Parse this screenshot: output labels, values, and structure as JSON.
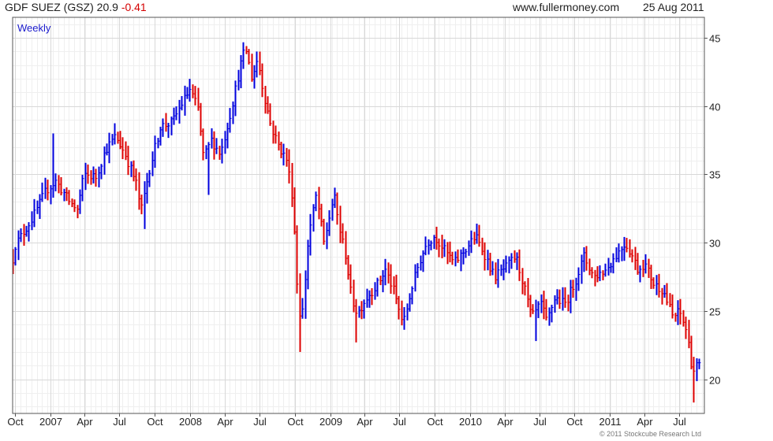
{
  "header": {
    "name": "GDF SUEZ (GSZ)",
    "price": "20.9",
    "change": "-0.41",
    "site": "www.fullermoney.com",
    "date": "25 Aug 2011"
  },
  "frequency_label": "Weekly",
  "copyright": "© 2011 Stockcube Research Ltd",
  "colors": {
    "up": "#0000dd",
    "down": "#dd0000",
    "grid": "#d8d8d8",
    "frame": "#555555"
  },
  "chart_data": {
    "type": "bar",
    "style": "hlc-price-bars",
    "frequency": "weekly",
    "y_axis_side": "right",
    "ylim": [
      17.5,
      46.5
    ],
    "yticks": [
      20,
      25,
      30,
      35,
      40,
      45
    ],
    "xlim": [
      "2006-09-25",
      "2011-09-05"
    ],
    "xticks": [
      {
        "label": "Oct",
        "date": "2006-10-01"
      },
      {
        "label": "2007",
        "date": "2007-01-01"
      },
      {
        "label": "Apr",
        "date": "2007-04-01"
      },
      {
        "label": "Jul",
        "date": "2007-07-01"
      },
      {
        "label": "Oct",
        "date": "2007-10-01"
      },
      {
        "label": "2008",
        "date": "2008-01-01"
      },
      {
        "label": "Apr",
        "date": "2008-04-01"
      },
      {
        "label": "Jul",
        "date": "2008-07-01"
      },
      {
        "label": "Oct",
        "date": "2008-10-01"
      },
      {
        "label": "2009",
        "date": "2009-01-01"
      },
      {
        "label": "Apr",
        "date": "2009-04-01"
      },
      {
        "label": "Jul",
        "date": "2009-07-01"
      },
      {
        "label": "Oct",
        "date": "2009-10-01"
      },
      {
        "label": "2010",
        "date": "2010-01-01"
      },
      {
        "label": "Apr",
        "date": "2010-04-01"
      },
      {
        "label": "Jul",
        "date": "2010-07-01"
      },
      {
        "label": "Oct",
        "date": "2010-10-01"
      },
      {
        "label": "2011",
        "date": "2011-01-01"
      },
      {
        "label": "Apr",
        "date": "2011-04-01"
      },
      {
        "label": "Jul",
        "date": "2011-07-01"
      }
    ],
    "close_path": [
      [
        "2006-09-25",
        28.8
      ],
      [
        "2006-10-01",
        29.8
      ],
      [
        "2006-11-15",
        31.8
      ],
      [
        "2006-12-20",
        33.8
      ],
      [
        "2007-01-15",
        34.5
      ],
      [
        "2007-02-20",
        33.0
      ],
      [
        "2007-03-12",
        32.4
      ],
      [
        "2007-03-30",
        35.0
      ],
      [
        "2007-04-30",
        34.8
      ],
      [
        "2007-05-25",
        36.8
      ],
      [
        "2007-06-20",
        37.8
      ],
      [
        "2007-07-15",
        36.5
      ],
      [
        "2007-08-15",
        34.2
      ],
      [
        "2007-08-25",
        32.2
      ],
      [
        "2007-09-15",
        35.2
      ],
      [
        "2007-10-15",
        38.5
      ],
      [
        "2007-11-15",
        38.8
      ],
      [
        "2007-12-10",
        40.2
      ],
      [
        "2007-12-31",
        41.2
      ],
      [
        "2008-01-21",
        39.8
      ],
      [
        "2008-02-05",
        36.2
      ],
      [
        "2008-02-25",
        37.5
      ],
      [
        "2008-03-20",
        36.5
      ],
      [
        "2008-04-15",
        39.5
      ],
      [
        "2008-05-15",
        43.5
      ],
      [
        "2008-05-25",
        44.2
      ],
      [
        "2008-06-10",
        42.0
      ],
      [
        "2008-06-25",
        43.5
      ],
      [
        "2008-07-10",
        41.0
      ],
      [
        "2008-07-30",
        38.5
      ],
      [
        "2008-08-20",
        37.0
      ],
      [
        "2008-09-10",
        36.0
      ],
      [
        "2008-09-25",
        33.0
      ],
      [
        "2008-10-08",
        26.0
      ],
      [
        "2008-10-17",
        24.0
      ],
      [
        "2008-11-05",
        30.5
      ],
      [
        "2008-11-25",
        33.5
      ],
      [
        "2008-12-15",
        30.0
      ],
      [
        "2009-01-10",
        33.5
      ],
      [
        "2009-01-25",
        31.0
      ],
      [
        "2009-02-10",
        29.0
      ],
      [
        "2009-02-25",
        26.0
      ],
      [
        "2009-03-12",
        24.8
      ],
      [
        "2009-04-01",
        25.8
      ],
      [
        "2009-05-05",
        27.0
      ],
      [
        "2009-05-25",
        28.0
      ],
      [
        "2009-06-15",
        26.5
      ],
      [
        "2009-07-10",
        24.0
      ],
      [
        "2009-07-31",
        26.5
      ],
      [
        "2009-08-20",
        28.5
      ],
      [
        "2009-09-10",
        30.0
      ],
      [
        "2009-09-30",
        30.5
      ],
      [
        "2009-10-25",
        29.5
      ],
      [
        "2009-11-20",
        28.5
      ],
      [
        "2009-12-20",
        29.5
      ],
      [
        "2010-01-15",
        30.5
      ],
      [
        "2010-02-10",
        29.0
      ],
      [
        "2010-03-05",
        27.5
      ],
      [
        "2010-04-05",
        28.2
      ],
      [
        "2010-04-30",
        29.0
      ],
      [
        "2010-05-20",
        27.0
      ],
      [
        "2010-06-10",
        24.5
      ],
      [
        "2010-07-05",
        25.5
      ],
      [
        "2010-07-20",
        24.2
      ],
      [
        "2010-08-10",
        26.0
      ],
      [
        "2010-09-05",
        25.5
      ],
      [
        "2010-09-30",
        27.0
      ],
      [
        "2010-10-25",
        29.0
      ],
      [
        "2010-11-20",
        27.5
      ],
      [
        "2010-12-20",
        28.0
      ],
      [
        "2011-01-15",
        29.0
      ],
      [
        "2011-02-10",
        30.0
      ],
      [
        "2011-03-01",
        29.0
      ],
      [
        "2011-03-15",
        28.0
      ],
      [
        "2011-04-01",
        28.5
      ],
      [
        "2011-04-25",
        27.0
      ],
      [
        "2011-05-20",
        26.5
      ],
      [
        "2011-06-15",
        24.5
      ],
      [
        "2011-07-01",
        25.0
      ],
      [
        "2011-07-20",
        23.5
      ],
      [
        "2011-08-05",
        20.5
      ],
      [
        "2011-08-15",
        21.0
      ],
      [
        "2011-08-25",
        20.9
      ]
    ],
    "spikes": [
      {
        "date": "2007-01-08",
        "high": 38.0,
        "low": 33.5
      },
      {
        "date": "2007-09-03",
        "high": 34.5,
        "low": 31.0
      },
      {
        "date": "2008-02-18",
        "high": 37.0,
        "low": 33.5
      },
      {
        "date": "2008-10-13",
        "high": 25.0,
        "low": 22.0
      },
      {
        "date": "2009-03-09",
        "high": 25.5,
        "low": 22.7
      },
      {
        "date": "2010-06-21",
        "high": 25.0,
        "low": 22.8
      },
      {
        "date": "2011-08-08",
        "high": 21.0,
        "low": 18.3
      }
    ]
  }
}
